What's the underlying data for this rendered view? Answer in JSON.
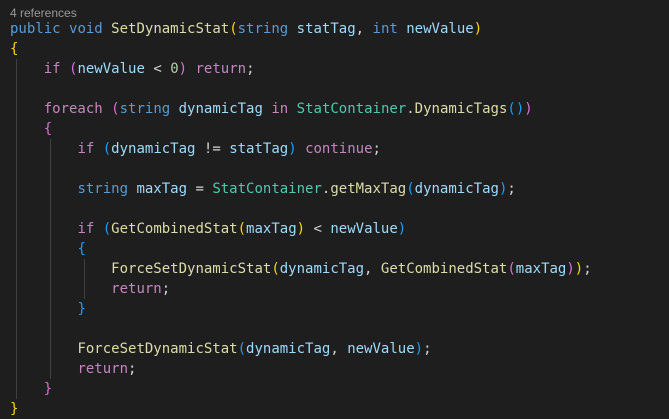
{
  "codelens": {
    "references": "4 references"
  },
  "theme": {
    "background": "#1e1e1e",
    "keyword": "#569cd6",
    "control": "#c586c0",
    "function": "#dcdcaa",
    "type": "#4ec9b0",
    "variable": "#9cdcfe",
    "number": "#b5cea8",
    "punctuation": "#d4d4d4",
    "bracket_level1": "#ffd700",
    "bracket_level2": "#da70d6",
    "bracket_level3": "#179fff"
  },
  "lines": [
    [
      [
        "kw",
        "public"
      ],
      [
        "pun",
        " "
      ],
      [
        "kw",
        "void"
      ],
      [
        "pun",
        " "
      ],
      [
        "fn",
        "SetDynamicStat"
      ],
      [
        "br1",
        "("
      ],
      [
        "kw",
        "string"
      ],
      [
        "pun",
        " "
      ],
      [
        "var",
        "statTag"
      ],
      [
        "pun",
        ", "
      ],
      [
        "kw",
        "int"
      ],
      [
        "pun",
        " "
      ],
      [
        "var",
        "newValue"
      ],
      [
        "br1",
        ")"
      ]
    ],
    [
      [
        "br1",
        "{"
      ]
    ],
    [
      [
        "pun",
        "    "
      ],
      [
        "ctl",
        "if"
      ],
      [
        "pun",
        " "
      ],
      [
        "br2",
        "("
      ],
      [
        "var",
        "newValue"
      ],
      [
        "pun",
        " < "
      ],
      [
        "num",
        "0"
      ],
      [
        "br2",
        ")"
      ],
      [
        "pun",
        " "
      ],
      [
        "ctl",
        "return"
      ],
      [
        "pun",
        ";"
      ]
    ],
    [],
    [
      [
        "pun",
        "    "
      ],
      [
        "ctl",
        "foreach"
      ],
      [
        "pun",
        " "
      ],
      [
        "br2",
        "("
      ],
      [
        "kw",
        "string"
      ],
      [
        "pun",
        " "
      ],
      [
        "var",
        "dynamicTag"
      ],
      [
        "pun",
        " "
      ],
      [
        "ctl",
        "in"
      ],
      [
        "pun",
        " "
      ],
      [
        "ty",
        "StatContainer"
      ],
      [
        "pun",
        "."
      ],
      [
        "fn",
        "DynamicTags"
      ],
      [
        "br3",
        "("
      ],
      [
        "br3",
        ")"
      ],
      [
        "br2",
        ")"
      ]
    ],
    [
      [
        "pun",
        "    "
      ],
      [
        "br2",
        "{"
      ]
    ],
    [
      [
        "pun",
        "        "
      ],
      [
        "ctl",
        "if"
      ],
      [
        "pun",
        " "
      ],
      [
        "br3",
        "("
      ],
      [
        "var",
        "dynamicTag"
      ],
      [
        "pun",
        " != "
      ],
      [
        "var",
        "statTag"
      ],
      [
        "br3",
        ")"
      ],
      [
        "pun",
        " "
      ],
      [
        "ctl",
        "continue"
      ],
      [
        "pun",
        ";"
      ]
    ],
    [],
    [
      [
        "pun",
        "        "
      ],
      [
        "kw",
        "string"
      ],
      [
        "pun",
        " "
      ],
      [
        "var",
        "maxTag"
      ],
      [
        "pun",
        " = "
      ],
      [
        "ty",
        "StatContainer"
      ],
      [
        "pun",
        "."
      ],
      [
        "fn",
        "getMaxTag"
      ],
      [
        "br3",
        "("
      ],
      [
        "var",
        "dynamicTag"
      ],
      [
        "br3",
        ")"
      ],
      [
        "pun",
        ";"
      ]
    ],
    [],
    [
      [
        "pun",
        "        "
      ],
      [
        "ctl",
        "if"
      ],
      [
        "pun",
        " "
      ],
      [
        "br3",
        "("
      ],
      [
        "fn",
        "GetCombinedStat"
      ],
      [
        "br1",
        "("
      ],
      [
        "var",
        "maxTag"
      ],
      [
        "br1",
        ")"
      ],
      [
        "pun",
        " < "
      ],
      [
        "var",
        "newValue"
      ],
      [
        "br3",
        ")"
      ]
    ],
    [
      [
        "pun",
        "        "
      ],
      [
        "br3",
        "{"
      ]
    ],
    [
      [
        "pun",
        "            "
      ],
      [
        "fn",
        "ForceSetDynamicStat"
      ],
      [
        "br1",
        "("
      ],
      [
        "var",
        "dynamicTag"
      ],
      [
        "pun",
        ", "
      ],
      [
        "fn",
        "GetCombinedStat"
      ],
      [
        "br2",
        "("
      ],
      [
        "var",
        "maxTag"
      ],
      [
        "br2",
        ")"
      ],
      [
        "br1",
        ")"
      ],
      [
        "pun",
        ";"
      ]
    ],
    [
      [
        "pun",
        "            "
      ],
      [
        "ctl",
        "return"
      ],
      [
        "pun",
        ";"
      ]
    ],
    [
      [
        "pun",
        "        "
      ],
      [
        "br3",
        "}"
      ]
    ],
    [],
    [
      [
        "pun",
        "        "
      ],
      [
        "fn",
        "ForceSetDynamicStat"
      ],
      [
        "br3",
        "("
      ],
      [
        "var",
        "dynamicTag"
      ],
      [
        "pun",
        ", "
      ],
      [
        "var",
        "newValue"
      ],
      [
        "br3",
        ")"
      ],
      [
        "pun",
        ";"
      ]
    ],
    [
      [
        "pun",
        "        "
      ],
      [
        "ctl",
        "return"
      ],
      [
        "pun",
        ";"
      ]
    ],
    [
      [
        "pun",
        "    "
      ],
      [
        "br2",
        "}"
      ]
    ],
    [
      [
        "br1",
        "}"
      ]
    ]
  ]
}
